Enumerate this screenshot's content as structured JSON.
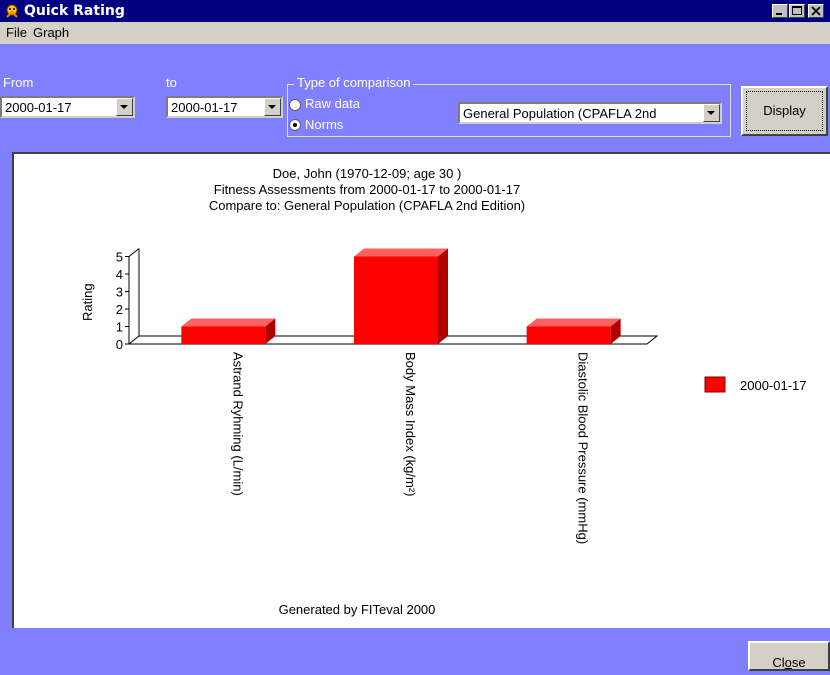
{
  "window": {
    "title": "Quick Rating",
    "controls": [
      "minimize-icon",
      "maximize-icon",
      "close-icon"
    ]
  },
  "menu": [
    {
      "label": "File"
    },
    {
      "label": "Graph"
    }
  ],
  "filters": {
    "from_label": "From",
    "from_value": "2000-01-17",
    "to_label": "to",
    "to_value": "2000-01-17",
    "comparison_group_label": "Type of comparison",
    "radio_raw_label": "Raw data",
    "radio_norms_label": "Norms",
    "selected_comparison": "Norms",
    "norm_value": "General Population (CPAFLA 2nd",
    "display_label": "Display"
  },
  "chart_data": {
    "type": "bar",
    "title_lines": [
      "Doe, John (1970-12-09; age 30 )",
      "Fitness Assessments from 2000-01-17 to 2000-01-17",
      "Compare to: General Population (CPAFLA 2nd Edition)"
    ],
    "ylabel": "Rating",
    "yticks": [
      0,
      1,
      2,
      3,
      4,
      5
    ],
    "ylim": [
      0,
      5
    ],
    "categories": [
      "Astrand Ryhming (L/min)",
      "Body Mass Index (kg/m²)",
      "Diastolic Blood Pressure (mmHg)"
    ],
    "series": [
      {
        "name": "2000-01-17",
        "values": [
          1,
          5,
          1
        ],
        "color": "#ff0000"
      }
    ],
    "legend_position": "right",
    "footer": "Generated by FITeval 2000",
    "style": "3d"
  },
  "footer": {
    "close_label": "Close"
  },
  "colors": {
    "window_bg": "#8080ff",
    "titlebar": "#000080",
    "bar": "#ff0000",
    "bar_top": "#ff6060",
    "bar_side": "#b00000"
  }
}
